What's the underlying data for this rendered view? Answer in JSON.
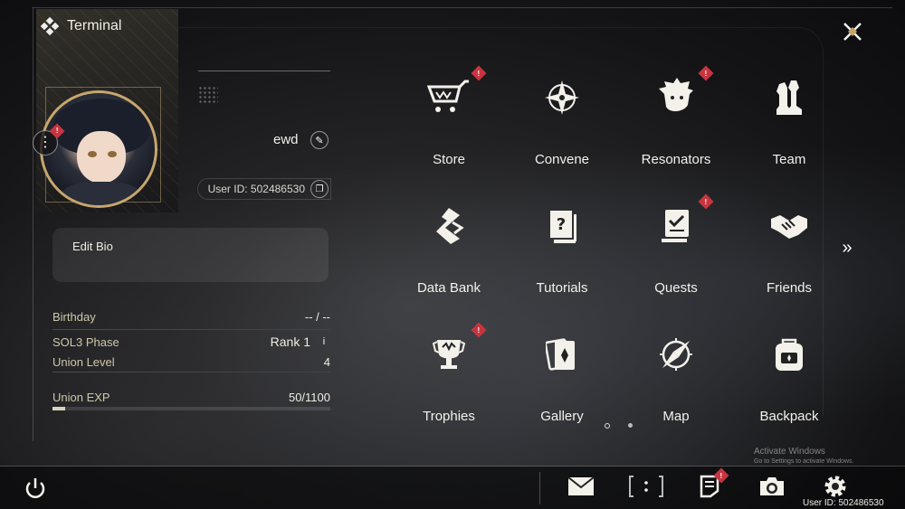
{
  "header": {
    "title": "Terminal",
    "logo_icon": "terminal-diamond-icon",
    "close_icon": "close-x-icon"
  },
  "profile": {
    "name": "ewd",
    "user_id_label": "User ID: 502486530",
    "bio_label": "Edit Bio",
    "stats": [
      {
        "key": "Birthday",
        "value": "-- / --"
      },
      {
        "key": "SOL3 Phase",
        "value": "Rank 1"
      },
      {
        "key": "Union Level",
        "value": "4"
      },
      {
        "key": "Union EXP",
        "value": "50/1100"
      }
    ],
    "exp_fraction": 0.045,
    "info_glyph": "i",
    "badge_glyph": "!"
  },
  "menu": {
    "items": [
      {
        "label": "Store",
        "icon": "cart-icon",
        "badge": true
      },
      {
        "label": "Convene",
        "icon": "compass-star-icon",
        "badge": false
      },
      {
        "label": "Resonators",
        "icon": "character-head-icon",
        "badge": true
      },
      {
        "label": "Team",
        "icon": "chess-pieces-icon",
        "badge": false
      },
      {
        "label": "Data Bank",
        "icon": "data-bank-icon",
        "badge": false
      },
      {
        "label": "Tutorials",
        "icon": "question-book-icon",
        "badge": false
      },
      {
        "label": "Quests",
        "icon": "checklist-icon",
        "badge": true
      },
      {
        "label": "Friends",
        "icon": "handshake-icon",
        "badge": false
      },
      {
        "label": "Trophies",
        "icon": "trophy-icon",
        "badge": true
      },
      {
        "label": "Gallery",
        "icon": "cards-icon",
        "badge": false
      },
      {
        "label": "Map",
        "icon": "compass-needle-icon",
        "badge": false
      },
      {
        "label": "Backpack",
        "icon": "backpack-icon",
        "badge": false
      }
    ],
    "next_icon": "double-chevron-right-icon",
    "page_count": 2,
    "active_page": 1
  },
  "watermark": {
    "line1": "Activate Windows",
    "line2": "Go to Settings to activate Windows."
  },
  "bottom_bar": {
    "power_icon": "power-icon",
    "mail_icon": "mail-icon",
    "scan_icon": "bracket-scan-icon",
    "notes_icon": "notes-icon",
    "camera_icon": "camera-icon",
    "settings_icon": "gear-icon",
    "user_id": "User ID: 502486530"
  },
  "colors": {
    "badge": "#c8343f",
    "accent_gold": "#c7a66e",
    "text": "#f3f1ea"
  }
}
